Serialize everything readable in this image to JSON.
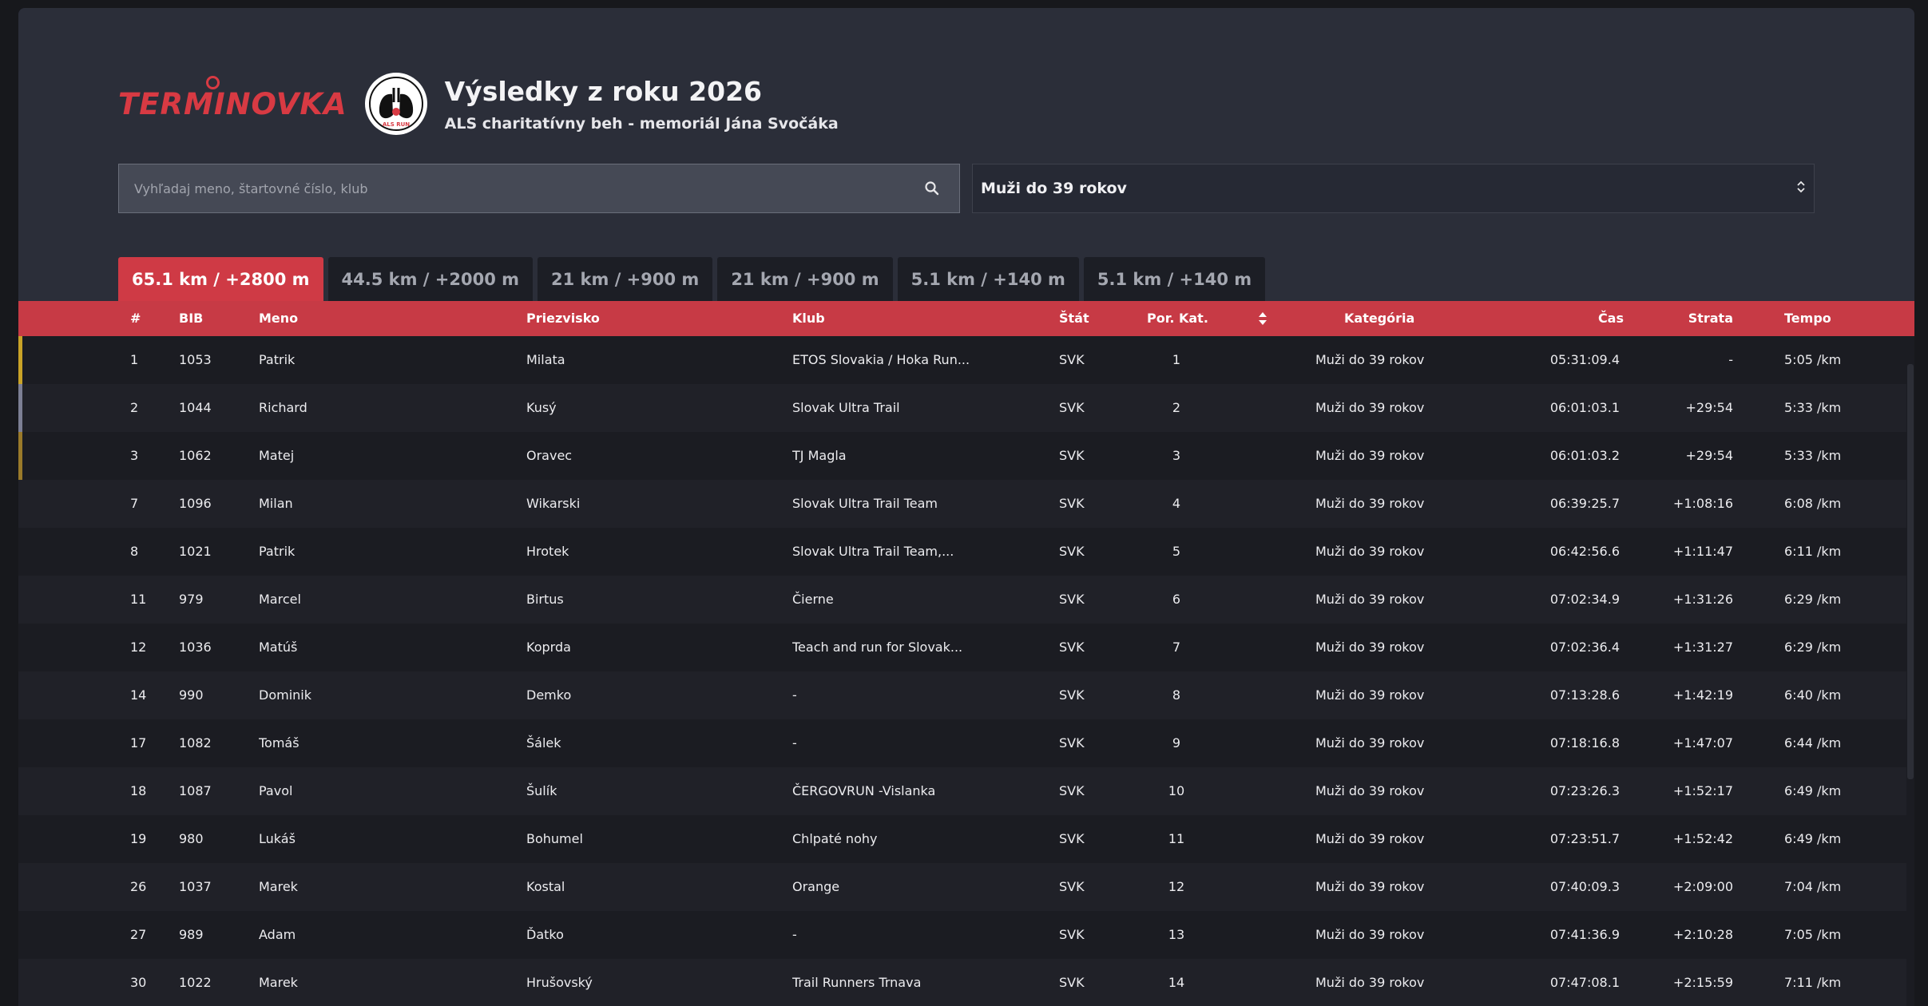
{
  "app": {
    "logo_text": "TERMINOVKA",
    "badge_text": "ALS RUN",
    "title": "Výsledky z roku 2026",
    "subtitle": "ALS charitatívny beh - memoriál Jána Svočáka"
  },
  "search": {
    "placeholder": "Vyhľadaj meno, štartovné číslo, klub",
    "value": ""
  },
  "category_select": {
    "selected": "Muži do 39 rokov"
  },
  "tabs": [
    {
      "label": "65.1 km / +2800 m",
      "active": true
    },
    {
      "label": "44.5 km / +2000 m",
      "active": false
    },
    {
      "label": "21 km / +900 m",
      "active": false
    },
    {
      "label": "21 km / +900 m",
      "active": false
    },
    {
      "label": "5.1 km / +140 m",
      "active": false
    },
    {
      "label": "5.1 km / +140 m",
      "active": false
    }
  ],
  "table": {
    "headers": {
      "rank": "#",
      "bib": "BIB",
      "first_name": "Meno",
      "last_name": "Priezvisko",
      "club": "Klub",
      "country": "Štát",
      "cat_rank": "Por. Kat.",
      "category": "Kategória",
      "time": "Čas",
      "gap": "Strata",
      "pace": "Tempo"
    },
    "rows": [
      {
        "rank": "1",
        "bib": "1053",
        "first_name": "Patrik",
        "last_name": "Milata",
        "club": "ETOS Slovakia / Hoka Run...",
        "country": "SVK",
        "cat_rank": "1",
        "category": "Muži do 39 rokov",
        "time": "05:31:09.4",
        "gap": "-",
        "pace": "5:05 /km",
        "medal": "gold"
      },
      {
        "rank": "2",
        "bib": "1044",
        "first_name": "Richard",
        "last_name": "Kusý",
        "club": "Slovak Ultra Trail",
        "country": "SVK",
        "cat_rank": "2",
        "category": "Muži do 39 rokov",
        "time": "06:01:03.1",
        "gap": "+29:54",
        "pace": "5:33 /km",
        "medal": "silver"
      },
      {
        "rank": "3",
        "bib": "1062",
        "first_name": "Matej",
        "last_name": "Oravec",
        "club": "TJ Magla",
        "country": "SVK",
        "cat_rank": "3",
        "category": "Muži do 39 rokov",
        "time": "06:01:03.2",
        "gap": "+29:54",
        "pace": "5:33 /km",
        "medal": "bronze"
      },
      {
        "rank": "7",
        "bib": "1096",
        "first_name": "Milan",
        "last_name": "Wikarski",
        "club": "Slovak Ultra Trail Team",
        "country": "SVK",
        "cat_rank": "4",
        "category": "Muži do 39 rokov",
        "time": "06:39:25.7",
        "gap": "+1:08:16",
        "pace": "6:08 /km",
        "medal": ""
      },
      {
        "rank": "8",
        "bib": "1021",
        "first_name": "Patrik",
        "last_name": "Hrotek",
        "club": "Slovak Ultra Trail Team,...",
        "country": "SVK",
        "cat_rank": "5",
        "category": "Muži do 39 rokov",
        "time": "06:42:56.6",
        "gap": "+1:11:47",
        "pace": "6:11 /km",
        "medal": ""
      },
      {
        "rank": "11",
        "bib": "979",
        "first_name": "Marcel",
        "last_name": "Birtus",
        "club": "Čierne",
        "country": "SVK",
        "cat_rank": "6",
        "category": "Muži do 39 rokov",
        "time": "07:02:34.9",
        "gap": "+1:31:26",
        "pace": "6:29 /km",
        "medal": ""
      },
      {
        "rank": "12",
        "bib": "1036",
        "first_name": "Matúš",
        "last_name": "Koprda",
        "club": "Teach and run for Slovak...",
        "country": "SVK",
        "cat_rank": "7",
        "category": "Muži do 39 rokov",
        "time": "07:02:36.4",
        "gap": "+1:31:27",
        "pace": "6:29 /km",
        "medal": ""
      },
      {
        "rank": "14",
        "bib": "990",
        "first_name": "Dominik",
        "last_name": "Demko",
        "club": "-",
        "country": "SVK",
        "cat_rank": "8",
        "category": "Muži do 39 rokov",
        "time": "07:13:28.6",
        "gap": "+1:42:19",
        "pace": "6:40 /km",
        "medal": ""
      },
      {
        "rank": "17",
        "bib": "1082",
        "first_name": "Tomáš",
        "last_name": "Šálek",
        "club": "-",
        "country": "SVK",
        "cat_rank": "9",
        "category": "Muži do 39 rokov",
        "time": "07:18:16.8",
        "gap": "+1:47:07",
        "pace": "6:44 /km",
        "medal": ""
      },
      {
        "rank": "18",
        "bib": "1087",
        "first_name": "Pavol",
        "last_name": "Šulík",
        "club": "ČERGOVRUN -Vislanka",
        "country": "SVK",
        "cat_rank": "10",
        "category": "Muži do 39 rokov",
        "time": "07:23:26.3",
        "gap": "+1:52:17",
        "pace": "6:49 /km",
        "medal": ""
      },
      {
        "rank": "19",
        "bib": "980",
        "first_name": "Lukáš",
        "last_name": "Bohumel",
        "club": "Chlpaté nohy",
        "country": "SVK",
        "cat_rank": "11",
        "category": "Muži do 39 rokov",
        "time": "07:23:51.7",
        "gap": "+1:52:42",
        "pace": "6:49 /km",
        "medal": ""
      },
      {
        "rank": "26",
        "bib": "1037",
        "first_name": "Marek",
        "last_name": "Kostal",
        "club": "Orange",
        "country": "SVK",
        "cat_rank": "12",
        "category": "Muži do 39 rokov",
        "time": "07:40:09.3",
        "gap": "+2:09:00",
        "pace": "7:04 /km",
        "medal": ""
      },
      {
        "rank": "27",
        "bib": "989",
        "first_name": "Adam",
        "last_name": "Ďatko",
        "club": "-",
        "country": "SVK",
        "cat_rank": "13",
        "category": "Muži do 39 rokov",
        "time": "07:41:36.9",
        "gap": "+2:10:28",
        "pace": "7:05 /km",
        "medal": ""
      },
      {
        "rank": "30",
        "bib": "1022",
        "first_name": "Marek",
        "last_name": "Hrušovský",
        "club": "Trail Runners Trnava",
        "country": "SVK",
        "cat_rank": "14",
        "category": "Muži do 39 rokov",
        "time": "07:47:08.1",
        "gap": "+2:15:59",
        "pace": "7:11 /km",
        "medal": ""
      }
    ]
  },
  "colors": {
    "accent": "#c73a45",
    "gold": "#c9a227",
    "silver": "#7c7f94",
    "bronze": "#9a7a2a"
  },
  "icons": {
    "search": "search-icon",
    "select": "up-down-chevron-icon",
    "sort": "sort-icon"
  }
}
